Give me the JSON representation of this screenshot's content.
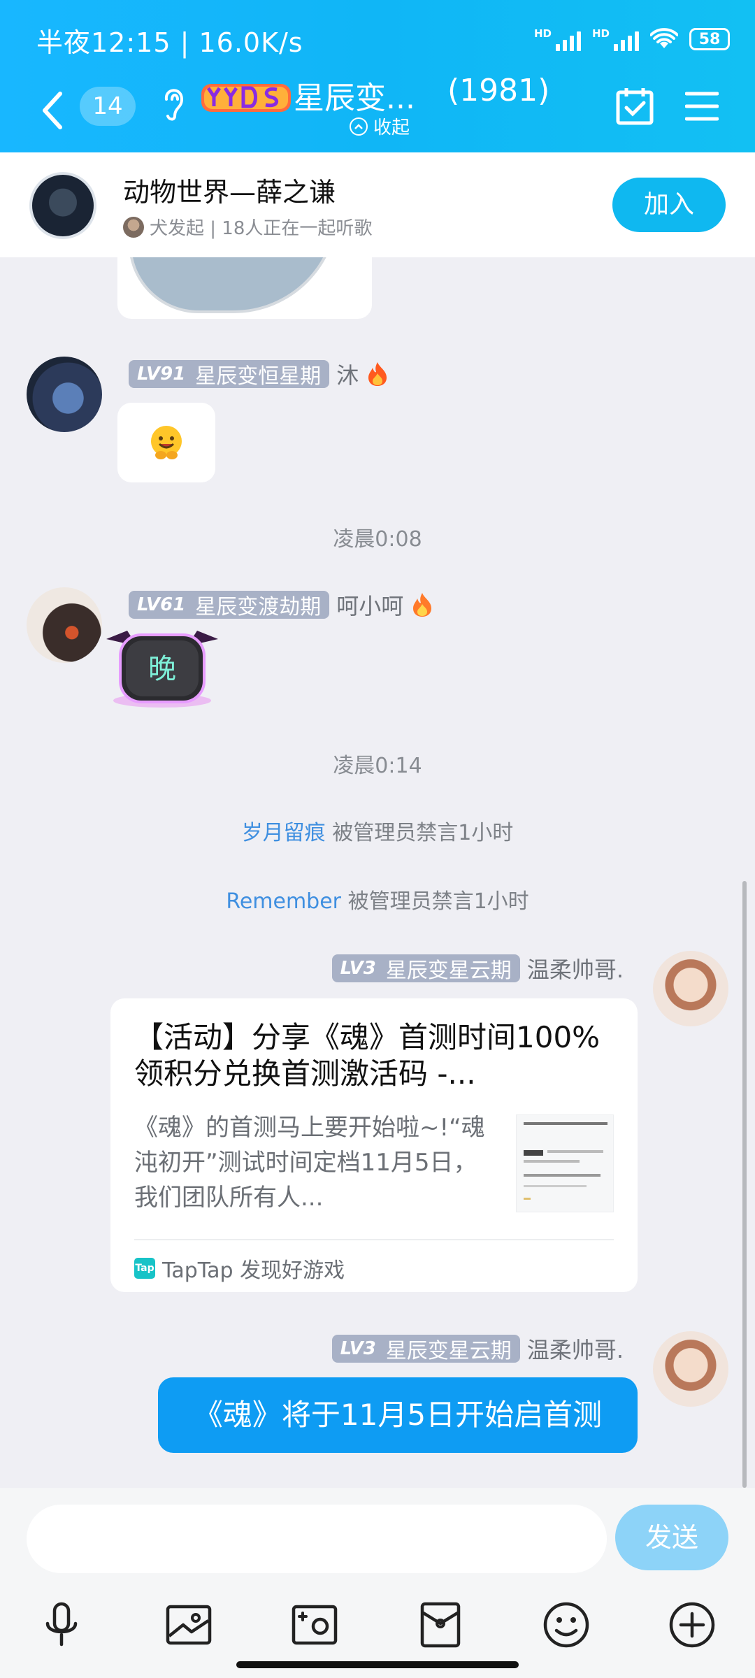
{
  "status": {
    "time_speed": "半夜12:15 | 16.0K/s",
    "net1": "HD",
    "net2": "HD",
    "battery": "58"
  },
  "header": {
    "unread": "14",
    "title": "星辰变...",
    "count": "(1981)",
    "collapse": "收起"
  },
  "listen": {
    "title": "动物世界—薛之谦",
    "sub": "犬发起 | 18人正在一起听歌",
    "join": "加入"
  },
  "messages": [
    {
      "level": "LV91",
      "title": "星辰变恒星期",
      "name": "沐"
    },
    {
      "level": "LV61",
      "title": "星辰变渡劫期",
      "name": "呵小呵",
      "sticker_text": "晚"
    },
    {
      "level": "LV3",
      "title": "星辰变星云期",
      "name": "温柔帅哥."
    },
    {
      "level": "LV3",
      "title": "星辰变星云期",
      "name": "温柔帅哥."
    }
  ],
  "times": [
    "凌晨0:08",
    "凌晨0:14"
  ],
  "system": [
    {
      "who": "岁月留痕",
      "text": " 被管理员禁言1小时"
    },
    {
      "who": "Remember",
      "text": " 被管理员禁言1小时"
    }
  ],
  "card": {
    "title": "【活动】分享《魂》首测时间100%领积分兑换首测激活码 -...",
    "desc": "《魂》的首测马上要开始啦~!“魂沌初开”测试时间定档11月5日，我们团队所有人...",
    "source": "TapTap 发现好游戏",
    "tap_label": "Tap"
  },
  "bubble": "《魂》将于11月5日开始启首测",
  "input": {
    "placeholder": "",
    "send": "发送"
  },
  "icons": [
    "microphone-icon",
    "image-icon",
    "camera-icon",
    "red-packet-icon",
    "emoji-icon",
    "plus-icon"
  ]
}
